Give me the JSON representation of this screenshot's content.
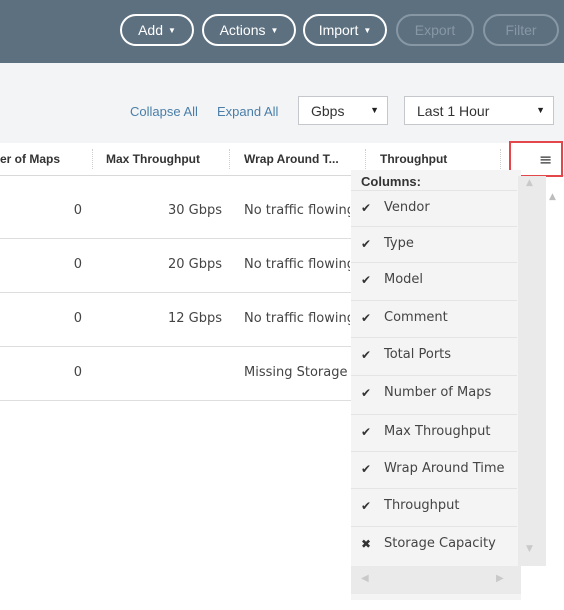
{
  "toolbar": {
    "add": "Add",
    "actions": "Actions",
    "import": "Import",
    "export": "Export",
    "filter": "Filter"
  },
  "subbar": {
    "collapse_all": "Collapse All",
    "expand_all": "Expand All",
    "unit_select": "Gbps",
    "time_select": "Last 1 Hour"
  },
  "table": {
    "columns": [
      "er of Maps",
      "Max Throughput",
      "Wrap Around T...",
      "Throughput"
    ],
    "rows": [
      {
        "maps": "0",
        "max_throughput": "30 Gbps",
        "wrap_around": "No traffic flowing"
      },
      {
        "maps": "0",
        "max_throughput": "20 Gbps",
        "wrap_around": "No traffic flowing"
      },
      {
        "maps": "0",
        "max_throughput": "12 Gbps",
        "wrap_around": "No traffic flowing"
      },
      {
        "maps": "0",
        "max_throughput": "",
        "wrap_around": "Missing Storage"
      }
    ]
  },
  "column_menu": {
    "title": "Columns:",
    "menu_glyph": "≡",
    "items": [
      {
        "label": "Vendor",
        "mark": "✔"
      },
      {
        "label": "Type",
        "mark": "✔"
      },
      {
        "label": "Model",
        "mark": "✔"
      },
      {
        "label": "Comment",
        "mark": "✔"
      },
      {
        "label": "Total Ports",
        "mark": "✔"
      },
      {
        "label": "Number of Maps",
        "mark": "✔"
      },
      {
        "label": "Max Throughput",
        "mark": "✔"
      },
      {
        "label": "Wrap Around Time",
        "mark": "✔"
      },
      {
        "label": "Throughput",
        "mark": "✔"
      },
      {
        "label": "Storage Capacity",
        "mark": "✖"
      }
    ]
  },
  "colors": {
    "toolbar_bg": "#5d7080",
    "link": "#4a7ea8",
    "highlight": "#e3474b"
  }
}
